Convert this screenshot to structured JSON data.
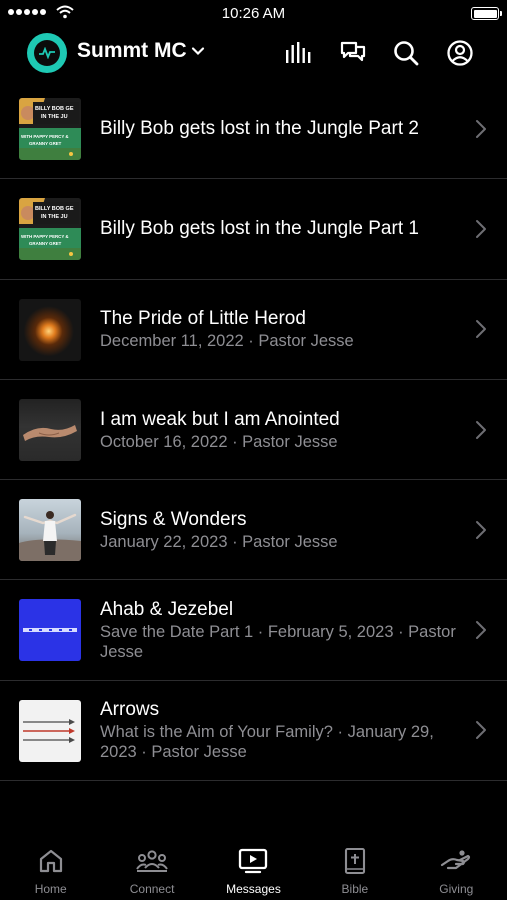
{
  "status_bar": {
    "time": "10:26 AM"
  },
  "header": {
    "org_name": "Summt MC"
  },
  "messages": [
    {
      "title": "Billy Bob gets lost in the Jungle Part 2",
      "subtitle": "",
      "thumb": "jungle",
      "thumb_text": [
        "BILLY BOB GE",
        "IN THE JU",
        "WITH PAPPY PERCY &",
        "GRANNY GRET"
      ]
    },
    {
      "title": "Billy Bob gets lost in the Jungle Part 1",
      "subtitle": "",
      "thumb": "jungle",
      "thumb_text": [
        "BILLY BOB GE",
        "IN THE JU",
        "WITH PAPPY PERCY &",
        "GRANNY GRET"
      ]
    },
    {
      "title": "The Pride of Little Herod",
      "subtitle": "December 11, 2022 · Pastor Jesse",
      "thumb": "fire"
    },
    {
      "title": "I am weak but I am Anointed",
      "subtitle": "October 16, 2022 · Pastor Jesse",
      "thumb": "hands"
    },
    {
      "title": "Signs & Wonders",
      "subtitle": "January 22, 2023 · Pastor Jesse",
      "thumb": "signs"
    },
    {
      "title": "Ahab & Jezebel",
      "subtitle": "Save the Date Part 1 · February 5, 2023 · Pastor Jesse",
      "thumb": "ahab"
    },
    {
      "title": "Arrows",
      "subtitle": "What is the Aim of Your Family? · January 29, 2023 · Pastor Jesse",
      "thumb": "arrows"
    }
  ],
  "tabs": [
    {
      "label": "Home",
      "icon": "home-icon",
      "active": false
    },
    {
      "label": "Connect",
      "icon": "people-icon",
      "active": false
    },
    {
      "label": "Messages",
      "icon": "play-screen-icon",
      "active": true
    },
    {
      "label": "Bible",
      "icon": "bible-icon",
      "active": false
    },
    {
      "label": "Giving",
      "icon": "giving-hand-icon",
      "active": false
    }
  ],
  "colors": {
    "accent": "#1ec9b4",
    "background": "#000000",
    "secondary_text": "#8e8e93",
    "divider": "#2c2c2e"
  }
}
